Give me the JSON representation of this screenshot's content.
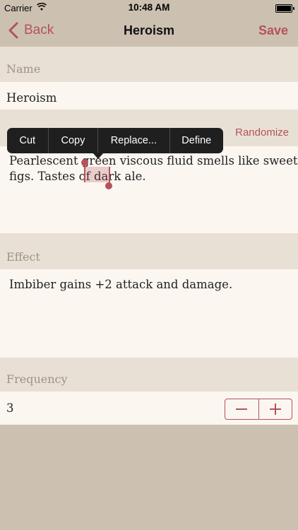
{
  "status_bar": {
    "carrier": "Carrier",
    "time": "10:48 AM"
  },
  "nav": {
    "back_label": "Back",
    "title": "Heroism",
    "save_label": "Save"
  },
  "name_section": {
    "label": "Name",
    "value": "Heroism"
  },
  "appearance_section": {
    "randomize_label": "Randomize",
    "line1": "Pearlescent green viscous fluid smells like sweet",
    "line2_before": "figs. Tastes of ",
    "line2_selected": "dark",
    "line2_after": " ale."
  },
  "context_menu": {
    "cut": "Cut",
    "copy": "Copy",
    "replace": "Replace...",
    "define": "Define"
  },
  "effect_section": {
    "label": "Effect",
    "value": "Imbiber gains +2 attack and damage."
  },
  "frequency_section": {
    "label": "Frequency",
    "value": "3"
  },
  "colors": {
    "accent": "#b5525a",
    "header_band": "#e9e0d5",
    "field_band": "#fbf6f0",
    "chrome": "#ccc1b1"
  }
}
